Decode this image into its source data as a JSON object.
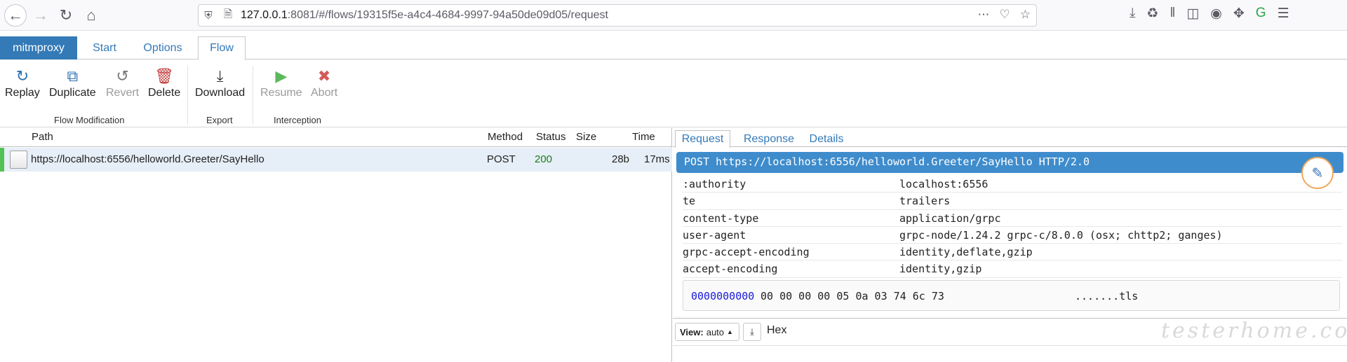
{
  "browser": {
    "url_host": "127.0.0.1",
    "url_rest": ":8081/#/flows/19315f5e-a4c4-4684-9997-94a50de09d05/request"
  },
  "tabs": {
    "mitmproxy": "mitmproxy",
    "start": "Start",
    "options": "Options",
    "flow": "Flow"
  },
  "ribbon": {
    "replay": "Replay",
    "duplicate": "Duplicate",
    "revert": "Revert",
    "delete": "Delete",
    "download": "Download",
    "resume": "Resume",
    "abort": "Abort",
    "group_flow_modification": "Flow Modification",
    "group_export": "Export",
    "group_interception": "Interception"
  },
  "flow_table": {
    "columns": {
      "path": "Path",
      "method": "Method",
      "status": "Status",
      "size": "Size",
      "time": "Time"
    },
    "rows": [
      {
        "path": "https://localhost:6556/helloworld.Greeter/SayHello",
        "method": "POST",
        "status": "200",
        "size": "28b",
        "time": "17ms"
      }
    ]
  },
  "detail": {
    "tabs": {
      "request": "Request",
      "response": "Response",
      "details": "Details"
    },
    "first_line": "POST https://localhost:6556/helloworld.Greeter/SayHello HTTP/2.0",
    "headers": [
      {
        "key": ":authority",
        "value": "localhost:6556"
      },
      {
        "key": "te",
        "value": "trailers"
      },
      {
        "key": "content-type",
        "value": "application/grpc"
      },
      {
        "key": "user-agent",
        "value": "grpc-node/1.24.2 grpc-c/8.0.0 (osx; chttp2; ganges)"
      },
      {
        "key": "grpc-accept-encoding",
        "value": "identity,deflate,gzip"
      },
      {
        "key": "accept-encoding",
        "value": "identity,gzip"
      }
    ],
    "hex": {
      "offset": "0000000000",
      "bytes": "00 00 00 00 05 0a 03 74 6c 73",
      "ascii": ".......tls"
    },
    "view_label": "View:",
    "view_value": "auto",
    "hex_label": "Hex"
  },
  "watermark": "testerhome.com"
}
